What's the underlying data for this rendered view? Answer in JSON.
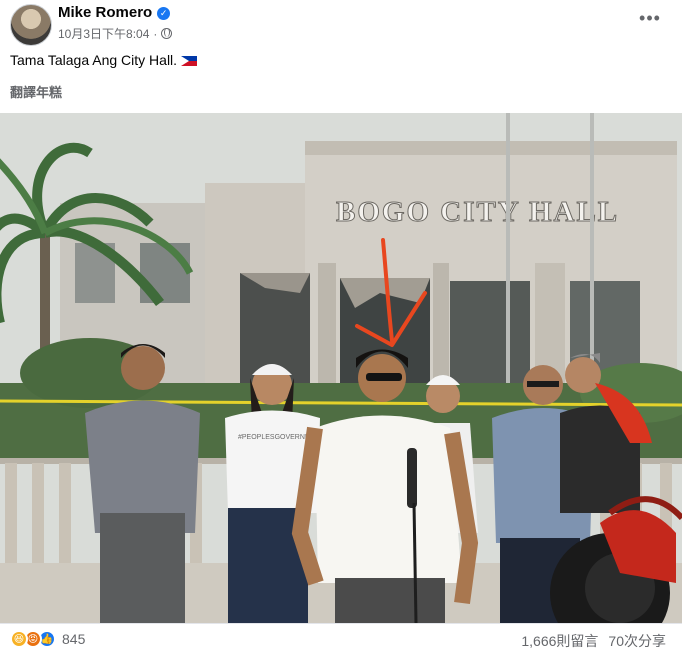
{
  "post": {
    "author": "Mike Romero",
    "timestamp": "10月3日下午8:04",
    "caption": "Tama Talaga Ang City Hall.",
    "translate_label": "翻譯年糕",
    "more_label": "•••"
  },
  "photo": {
    "sign_text": "BOGO CITY HALL",
    "shirt_text": "#PEOPLESGOVERNM"
  },
  "footer": {
    "reaction_count": "845",
    "comments": "1,666則留言",
    "shares": "70次分享"
  },
  "colors": {
    "accent": "#1877f2",
    "arrow": "#e8471f"
  },
  "icons": [
    "verified-icon",
    "globe-icon",
    "more-icon",
    "flag-icon",
    "haha-icon",
    "angry-icon",
    "like-icon"
  ]
}
